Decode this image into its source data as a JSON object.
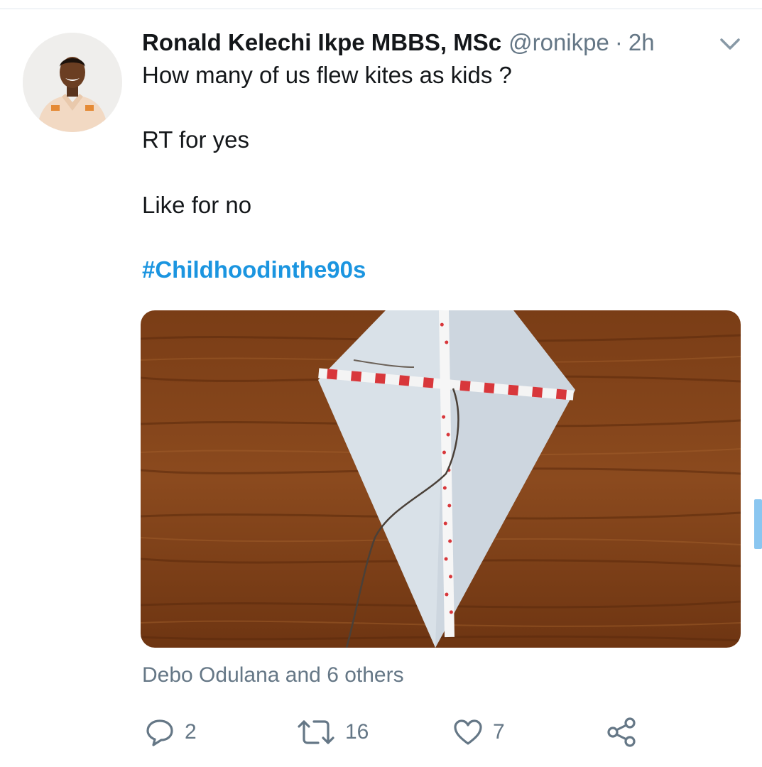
{
  "tweet": {
    "author_name": "Ronald Kelechi Ikpe MBBS, MSc",
    "handle": "@ronikpe",
    "separator": "·",
    "time": "2h",
    "lines": [
      "How many of us flew kites as kids ?",
      "RT for yes",
      "Like for no"
    ],
    "hashtag": "#Childhoodinthe90s",
    "media_description_icon": "kite-photo",
    "likers": "Debo Odulana and 6 others"
  },
  "actions": {
    "reply_count": "2",
    "retweet_count": "16",
    "like_count": "7"
  },
  "colors": {
    "link": "#1b95e0",
    "secondary_text": "#657786",
    "primary_text": "#14171a"
  },
  "icons": [
    "chevron-down-icon",
    "reply-icon",
    "retweet-icon",
    "like-icon",
    "share-icon"
  ]
}
